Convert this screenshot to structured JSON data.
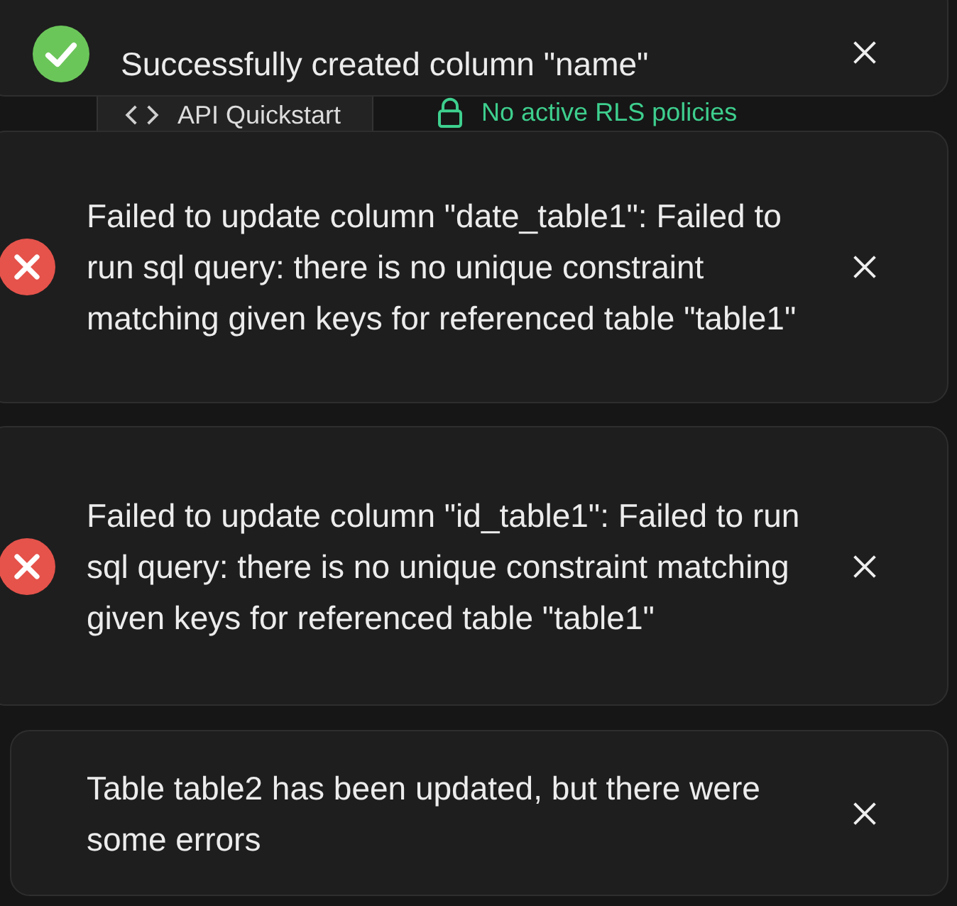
{
  "toolbar": {
    "api_button": "API Quickstart",
    "rls_status": "No active RLS policies"
  },
  "toasts": [
    {
      "kind": "success",
      "message": "Successfully created column \"name\""
    },
    {
      "kind": "error",
      "message": "Failed to update column \"date_table1\": Failed to run sql query: there is no unique constraint matching given keys for referenced table \"table1\""
    },
    {
      "kind": "error",
      "message": "Failed to update column \"id_table1\": Failed to run sql query: there is no unique constraint matching given keys for referenced table \"table1\""
    },
    {
      "kind": "info",
      "message": "Table table2 has been updated, but there were some errors"
    }
  ]
}
